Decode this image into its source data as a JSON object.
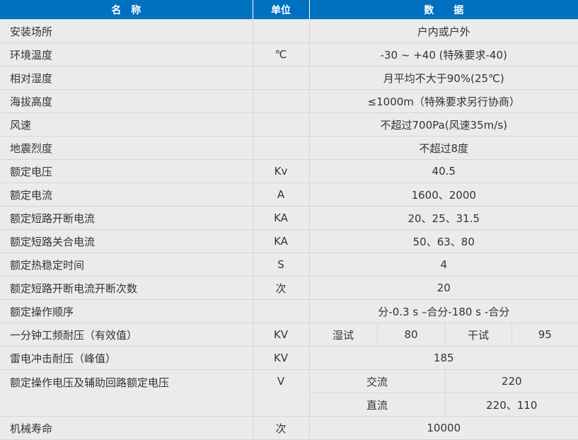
{
  "header": {
    "name": "名　称",
    "unit": "单位",
    "data": "数　　据"
  },
  "rows": [
    {
      "name": "安装场所",
      "unit": "",
      "value": "户内或户外"
    },
    {
      "name": "环境温度",
      "unit": "℃",
      "value": "-30 ~ +40 (特殊要求-40)"
    },
    {
      "name": "相对湿度",
      "unit": "",
      "value": "月平均不大于90%(25℃)"
    },
    {
      "name": "海拔高度",
      "unit": "",
      "value": "≤1000m（特殊要求另行协商）"
    },
    {
      "name": "风速",
      "unit": "",
      "value": "不超过700Pa(风速35m/s)"
    },
    {
      "name": "地震烈度",
      "unit": "",
      "value": "不超过8度"
    },
    {
      "name": "额定电压",
      "unit": "Kv",
      "value": "40.5"
    },
    {
      "name": "额定电流",
      "unit": "A",
      "value": "1600、2000"
    },
    {
      "name": "额定短路开断电流",
      "unit": "KA",
      "value": "20、25、31.5"
    },
    {
      "name": "额定短路关合电流",
      "unit": "KA",
      "value": "50、63、80"
    },
    {
      "name": "额定热稳定时间",
      "unit": "S",
      "value": "4"
    },
    {
      "name": "额定短路开断电流开断次数",
      "unit": "次",
      "value": "20"
    },
    {
      "name": "额定操作顺序",
      "unit": "",
      "value": "分-0.3 s –合分-180 s -合分"
    }
  ],
  "power_freq": {
    "name": "一分钟工频耐压（有效值）",
    "unit": "KV",
    "wet_label": "湿试",
    "wet_value": "80",
    "dry_label": "干试",
    "dry_value": "95"
  },
  "lightning": {
    "name": "雷电冲击耐压（峰值）",
    "unit": "KV",
    "value": "185"
  },
  "operating_voltage": {
    "name": "额定操作电压及辅助回路额定电压",
    "unit": "V",
    "ac_label": "交流",
    "ac_value": "220",
    "dc_label": "直流",
    "dc_value": "220、110"
  },
  "mech_life": {
    "name": "机械寿命",
    "unit": "次",
    "value": "10000"
  }
}
